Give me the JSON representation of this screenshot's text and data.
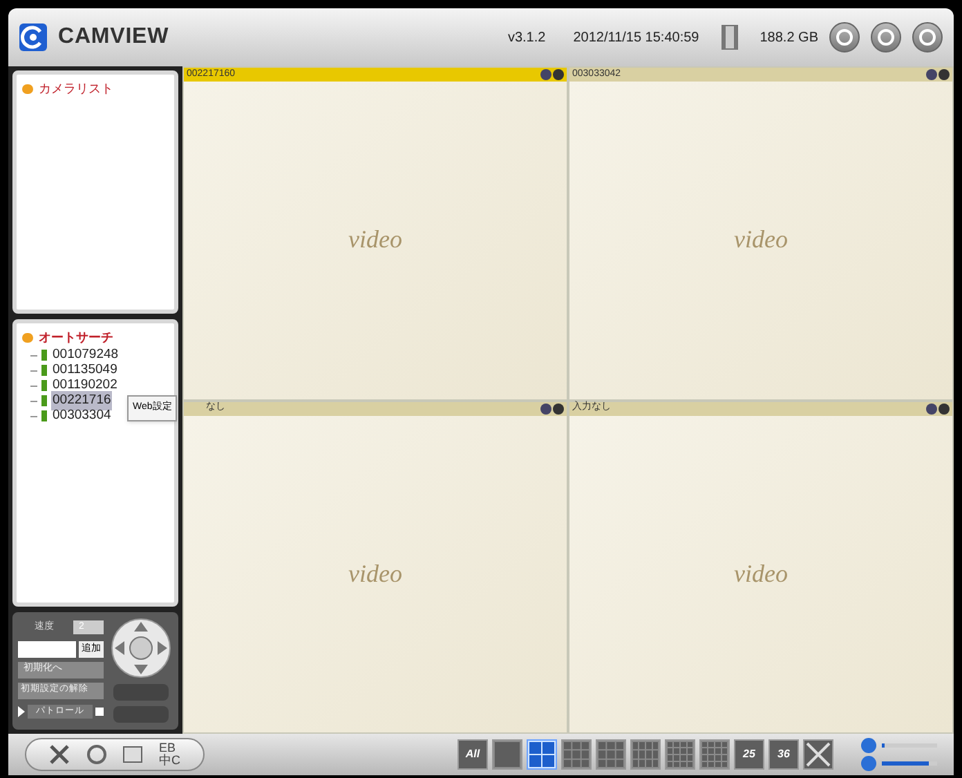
{
  "header": {
    "logo": "CAMVIEW",
    "version": "v3.1.2",
    "datetime": "2012/11/15 15:40:59",
    "storage": "188.2 GB"
  },
  "camera_list": {
    "title": "カメラリスト"
  },
  "auto_search": {
    "title": "オートサーチ",
    "items": [
      {
        "label": "001079248",
        "selected": false
      },
      {
        "label": "001135049",
        "selected": false
      },
      {
        "label": "001190202",
        "selected": false
      },
      {
        "label": "00221716",
        "selected": true
      },
      {
        "label": "00303304",
        "selected": false
      }
    ]
  },
  "context_menu": {
    "items": [
      "Web設定"
    ]
  },
  "ptz": {
    "speed_label": "速度",
    "speed_value": "2",
    "add_button": "追加",
    "preset_select": "初期化へ",
    "clear_select": "初期設定の解除",
    "patrol_label": "パトロール"
  },
  "video_cells": [
    {
      "label": "002217160",
      "selected": true,
      "placeholder": "video"
    },
    {
      "label": "003033042",
      "selected": false,
      "placeholder": "video"
    },
    {
      "label": "なし",
      "selected": false,
      "placeholder": "video"
    },
    {
      "label": "入力なし",
      "selected": false,
      "placeholder": "video"
    }
  ],
  "bottom_tools": {
    "language_top": "EB",
    "language_bottom": "中C"
  },
  "layouts": [
    {
      "kind": "all",
      "label": "All",
      "selected": false
    },
    {
      "kind": "single",
      "selected": false
    },
    {
      "kind": "quad",
      "selected": true
    },
    {
      "kind": "split6",
      "selected": false
    },
    {
      "kind": "grid9",
      "selected": false
    },
    {
      "kind": "split10",
      "selected": false
    },
    {
      "kind": "grid16",
      "selected": false
    },
    {
      "kind": "split8",
      "selected": false
    },
    {
      "kind": "number",
      "label": "25",
      "selected": false
    },
    {
      "kind": "number",
      "label": "36",
      "selected": false
    },
    {
      "kind": "fullscreen",
      "selected": false
    }
  ],
  "volume": [
    {
      "level": 0.05
    },
    {
      "level": 0.85
    }
  ]
}
